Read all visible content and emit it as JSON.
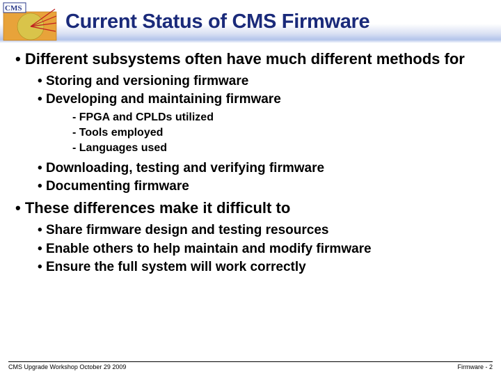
{
  "title": "Current Status of CMS Firmware",
  "logo_label": "CMS",
  "bullets1": [
    {
      "text": "Different subsystems often have much different methods for",
      "bullets2": [
        {
          "text": "Storing and versioning firmware"
        },
        {
          "text": "Developing and maintaining firmware",
          "bullets3": [
            "FPGA and CPLDs utilized",
            "Tools employed",
            "Languages used"
          ]
        },
        {
          "text": "Downloading, testing and verifying firmware"
        },
        {
          "text": "Documenting firmware"
        }
      ]
    },
    {
      "text": "These differences make it difficult to",
      "bullets2": [
        {
          "text": "Share firmware design and testing resources"
        },
        {
          "text": "Enable others to help maintain and modify firmware"
        },
        {
          "text": "Ensure the full system will work correctly"
        }
      ]
    }
  ],
  "footer": {
    "left": "CMS Upgrade Workshop October 29 2009",
    "right": "Firmware -  2"
  }
}
